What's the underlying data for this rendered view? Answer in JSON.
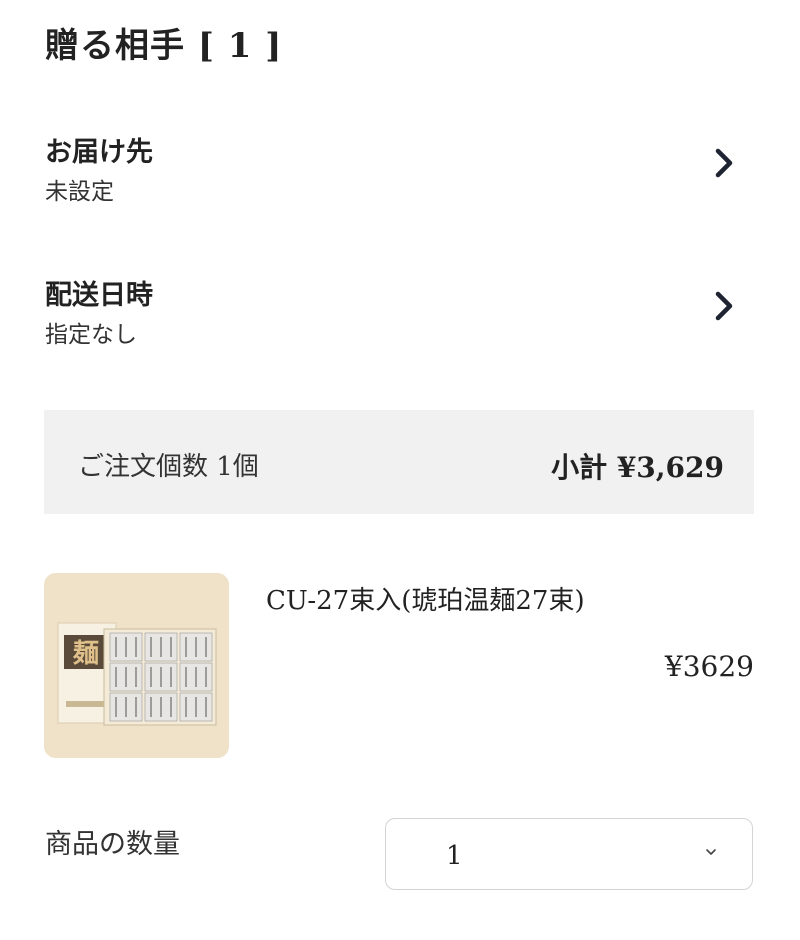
{
  "page": {
    "title": "贈る相手 [ 1 ]"
  },
  "delivery": {
    "label": "お届け先",
    "value": "未設定",
    "chevron_icon": "chevron-right-icon"
  },
  "schedule": {
    "label": "配送日時",
    "value": "指定なし",
    "chevron_icon": "chevron-right-icon"
  },
  "summary": {
    "order_count": "ご注文個数 1個",
    "subtotal": "小計 ¥3,629"
  },
  "product": {
    "name": "CU-27束入(琥珀温麺27束)",
    "price": "¥3629",
    "image_label": "麺"
  },
  "quantity": {
    "label": "商品の数量",
    "selected": "1",
    "caret_icon": "chevron-down-icon"
  }
}
